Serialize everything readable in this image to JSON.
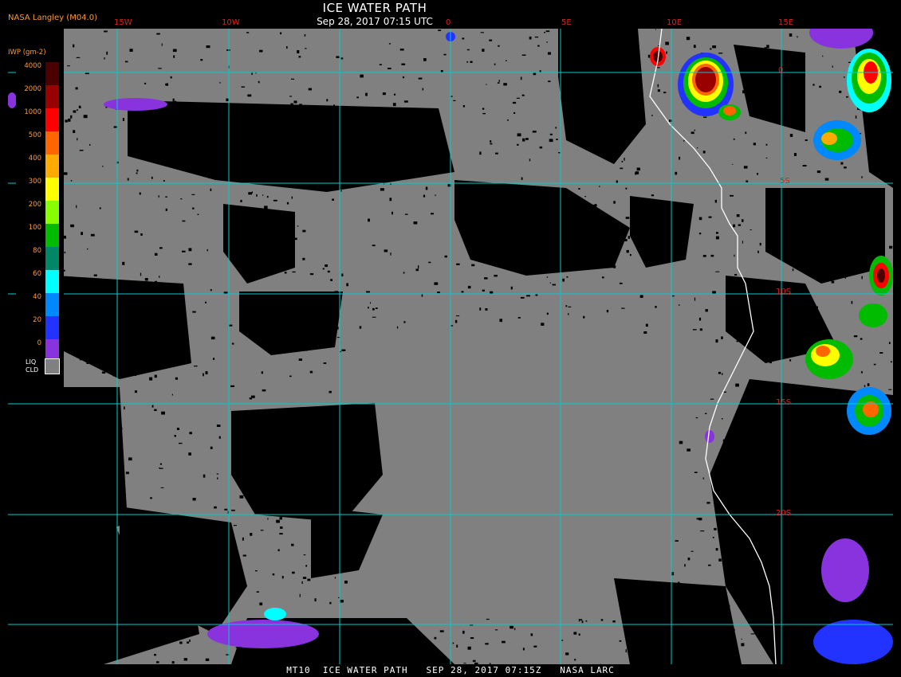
{
  "header": {
    "credit": "NASA Langley (M04.0)",
    "title": "ICE WATER PATH",
    "subtitle": "Sep 28, 2017 07:15 UTC"
  },
  "footer": {
    "text": "MT10  ICE WATER PATH   SEP 28, 2017 07:15Z   NASA LARC"
  },
  "grid": {
    "longitude_labels": [
      "15W",
      "10W",
      "0",
      "5E",
      "10E",
      "15E"
    ],
    "latitude_labels": [
      "0",
      "5S",
      "10S",
      "15S",
      "20S"
    ]
  },
  "legend": {
    "title": "IWP (gm-2)",
    "values": [
      "4000",
      "2000",
      "1000",
      "500",
      "400",
      "300",
      "200",
      "100",
      "80",
      "60",
      "40",
      "20",
      "0"
    ],
    "colors": [
      "#4a0000",
      "#990000",
      "#ff0000",
      "#ff6600",
      "#ffaa00",
      "#ffff00",
      "#88ff00",
      "#00bb00",
      "#008866",
      "#00ffff",
      "#0088ff",
      "#2233ff",
      "#8833dd"
    ],
    "liquid_label_line1": "LIQ",
    "liquid_label_line2": "CLD",
    "liquid_color": "#808080"
  },
  "colors": {
    "clear_sky": "#000000",
    "liquid_cloud": "#808080",
    "grid": "#00cccc",
    "label": "#e02020",
    "coastline": "#ffffff"
  }
}
